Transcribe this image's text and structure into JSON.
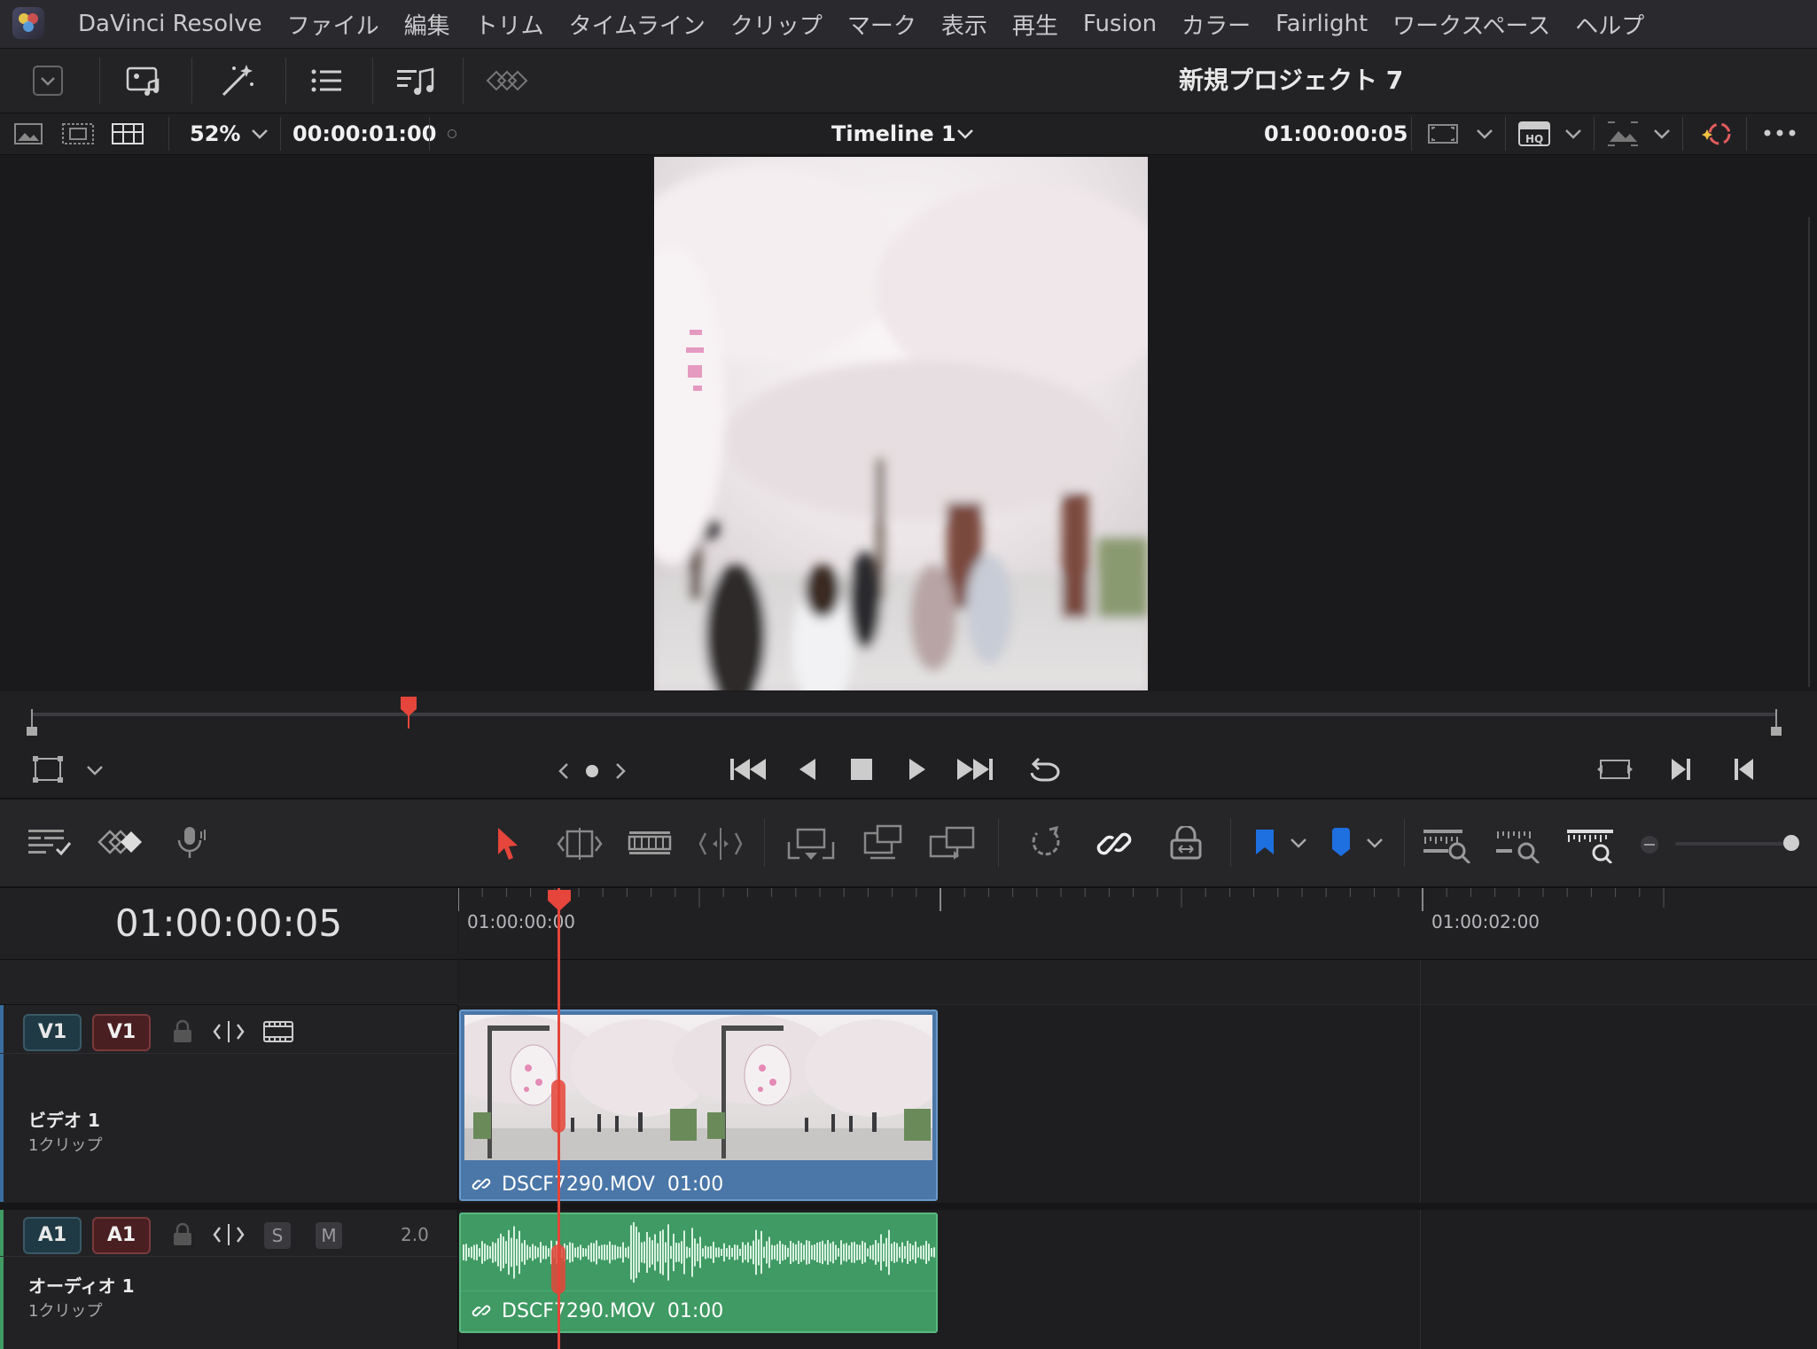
{
  "app": {
    "title": "DaVinci Resolve"
  },
  "menu": [
    "ファイル",
    "編集",
    "トリム",
    "タイムライン",
    "クリップ",
    "マーク",
    "表示",
    "再生",
    "Fusion",
    "カラー",
    "Fairlight",
    "ワークスペース",
    "ヘルプ"
  ],
  "toolbar": {
    "project_title": "新規プロジェクト 7"
  },
  "viewer": {
    "zoom": "52%",
    "source_timecode": "00:00:01:00",
    "timeline_name": "Timeline 1",
    "record_timecode": "01:00:00:05"
  },
  "scrubber": {
    "playhead_fraction": 0.22
  },
  "timeline": {
    "current_timecode": "01:00:00:05",
    "ruler_labels": [
      "01:00:00:00",
      "01:00:02:00"
    ]
  },
  "tracks": {
    "video": {
      "tag": "V1",
      "tag_dest": "V1",
      "name": "ビデオ 1",
      "count": "1クリップ",
      "clip_name": "DSCF7290.MOV",
      "clip_duration": "01:00"
    },
    "audio": {
      "tag": "A1",
      "tag_dest": "A1",
      "name": "オーディオ 1",
      "count": "1クリップ",
      "solo": "S",
      "mute": "M",
      "channels": "2.0",
      "clip_name": "DSCF7290.MOV",
      "clip_duration": "01:00"
    }
  },
  "colors": {
    "accent_red": "#e5453a",
    "video_clip": "#4a77a8",
    "audio_clip": "#3f9a63",
    "flag_blue": "#1e6fe0"
  }
}
